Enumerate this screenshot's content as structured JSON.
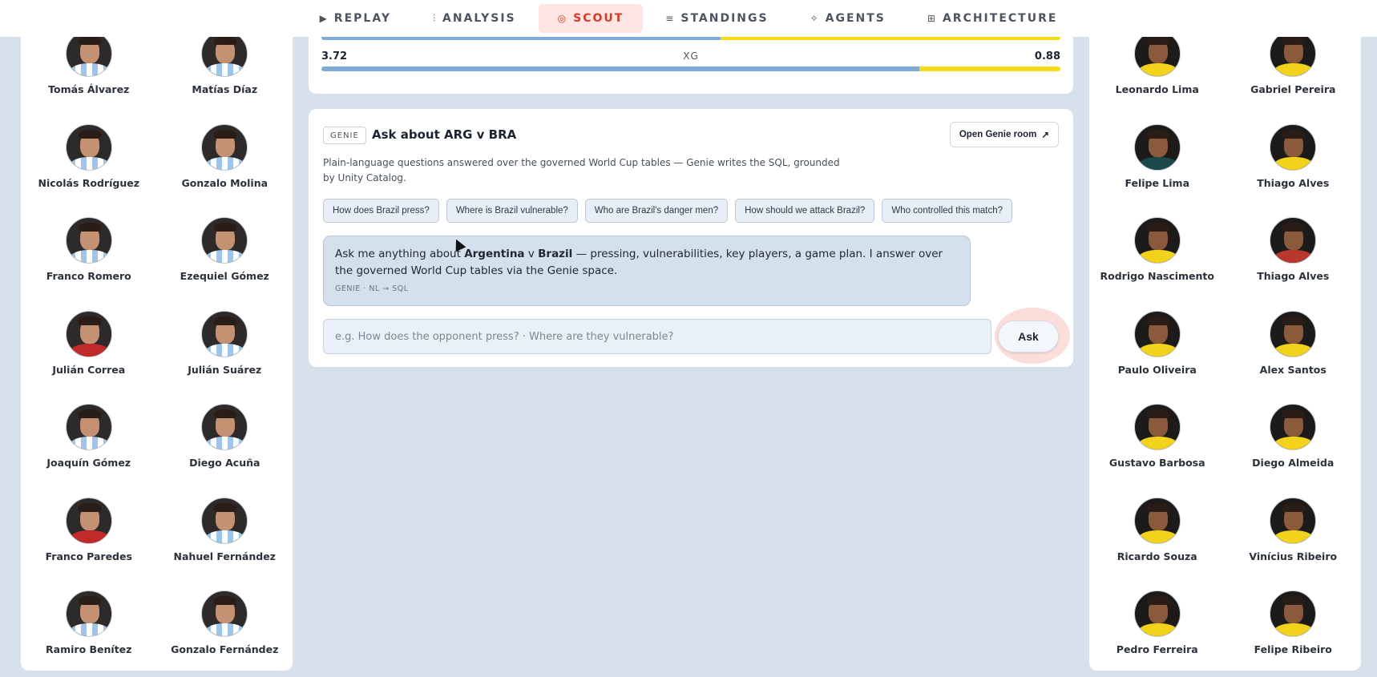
{
  "nav": {
    "tabs": [
      {
        "label": "REPLAY",
        "icon": "play-icon",
        "glyph": "▶",
        "active": false
      },
      {
        "label": "ANALYSIS",
        "icon": "bar-chart-icon",
        "glyph": "⫶",
        "active": false
      },
      {
        "label": "SCOUT",
        "icon": "target-icon",
        "glyph": "◎",
        "active": true
      },
      {
        "label": "STANDINGS",
        "icon": "list-icon",
        "glyph": "≡",
        "active": false
      },
      {
        "label": "AGENTS",
        "icon": "sparkle-icon",
        "glyph": "✧",
        "active": false
      },
      {
        "label": "ARCHITECTURE",
        "icon": "grid-icon",
        "glyph": "⊞",
        "active": false
      }
    ]
  },
  "home_roster": {
    "players": [
      "Tomás Álvarez",
      "Matías Díaz",
      "Nicolás Rodríguez",
      "Gonzalo Molina",
      "Franco Romero",
      "Ezequiel Gómez",
      "Julián Correa",
      "Julián Suárez",
      "Joaquín Gómez",
      "Diego Acuña",
      "Franco Paredes",
      "Nahuel Fernández",
      "Ramiro Benítez",
      "Gonzalo Fernández"
    ]
  },
  "away_roster": {
    "players": [
      "Leonardo Lima",
      "Gabriel Pereira",
      "Felipe Lima",
      "Thiago Alves",
      "Rodrigo Nascimento",
      "Thiago Alves",
      "Paulo Oliveira",
      "Alex Santos",
      "Gustavo Barbosa",
      "Diego Almeida",
      "Ricardo Souza",
      "Vinícius Ribeiro",
      "Pedro Ferreira",
      "Felipe Ribeiro"
    ]
  },
  "stats": {
    "xg": {
      "label": "XG",
      "home": "3.72",
      "away": "0.88",
      "home_share": 0.809
    },
    "previous_bar_home_share": 0.54
  },
  "colors": {
    "home": "#7eabd8",
    "away": "#f6dc16",
    "accent": "#d63a2c"
  },
  "genie": {
    "badge": "GENIE",
    "title": "Ask about ARG v BRA",
    "open_room": "Open Genie room",
    "open_room_icon": "external-link-icon",
    "description": "Plain-language questions answered over the governed World Cup tables — Genie writes the SQL, grounded by Unity Catalog.",
    "suggestions": [
      "How does Brazil press?",
      "Where is Brazil vulnerable?",
      "Who are Brazil's danger men?",
      "How should we attack Brazil?",
      "Who controlled this match?"
    ],
    "answer": {
      "pre": "Ask me anything about ",
      "team1": "Argentina",
      "mid": " v ",
      "team2": "Brazil",
      "post": " — pressing, vulnerabilities, key players, a game plan. I answer over the governed World Cup tables via the Genie space.",
      "meta": "GENIE · NL → SQL"
    },
    "input_value": "",
    "input_placeholder": "e.g. How does the opponent press? · Where are they vulnerable?",
    "ask_label": "Ask"
  }
}
